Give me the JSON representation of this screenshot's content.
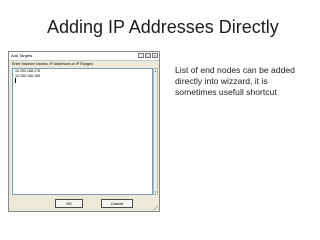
{
  "slide": {
    "title": "Adding IP Addresses Directly",
    "bullet": "List of end nodes can be added directly into wizzard, it is sometimes usefull shortcut"
  },
  "dialog": {
    "title": "Add Targets",
    "prompt": "Enter Machine Names, IP Addresses or IP Ranges:",
    "entries": [
      "10.250.168.178",
      "10.250.168.185"
    ],
    "ok_label": "OK",
    "cancel_label": "Cancel",
    "titlebar_icons": [
      "minimize-icon",
      "maximize-icon",
      "close-icon"
    ]
  }
}
